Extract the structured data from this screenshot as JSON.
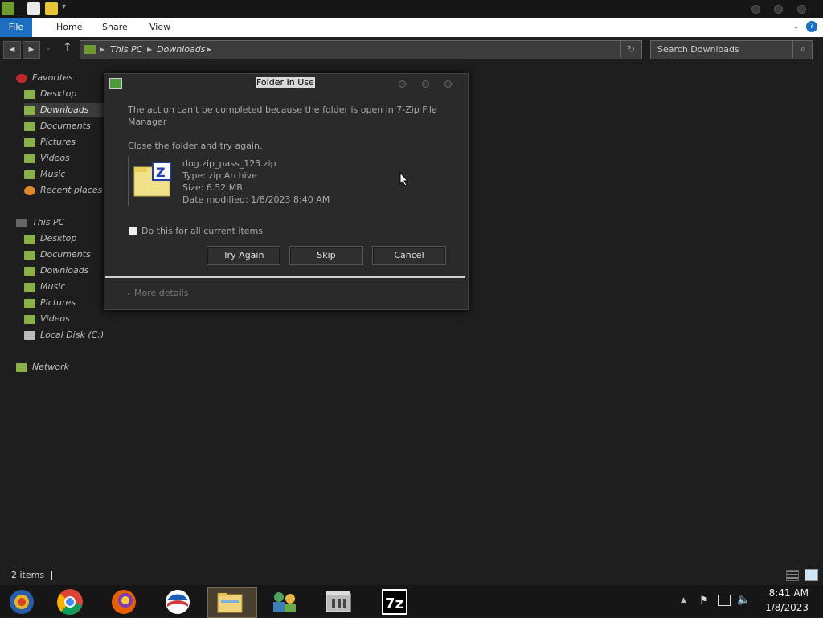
{
  "ribbon": {
    "tabs": [
      "File",
      "Home",
      "Share",
      "View"
    ]
  },
  "address": {
    "crumbs": [
      "This PC",
      "Downloads"
    ],
    "search_placeholder": "Search Downloads"
  },
  "nav": {
    "favorites_header": "Favorites",
    "favorites": [
      "Desktop",
      "Downloads",
      "Documents",
      "Pictures",
      "Videos",
      "Music",
      "Recent places"
    ],
    "thispc_header": "This PC",
    "thispc": [
      "Desktop",
      "Documents",
      "Downloads",
      "Music",
      "Pictures",
      "Videos",
      "Local Disk (C:)"
    ],
    "network": "Network"
  },
  "dialog": {
    "title": "Folder In Use",
    "message_line1": "The action can't be completed because the folder is open in 7-Zip File",
    "message_line2": "Manager",
    "instruction": "Close the folder and try again.",
    "file": {
      "name": "dog.zip_pass_123.zip",
      "type": "Type: zip Archive",
      "size": "Size: 6.52 MB",
      "modified": "Date modified: 1/8/2023 8:40 AM"
    },
    "checkbox_label": "Do this for all current items",
    "buttons": {
      "try_again": "Try Again",
      "skip": "Skip",
      "cancel": "Cancel"
    },
    "more_details": "More details"
  },
  "status": {
    "items": "2 items"
  },
  "clock": {
    "time": "8:41 AM",
    "date": "1/8/2023"
  },
  "colors": {
    "ribbon_file_tab": "#1b6ec2",
    "background": "#1e1e1e",
    "taskbar": "#161616"
  }
}
